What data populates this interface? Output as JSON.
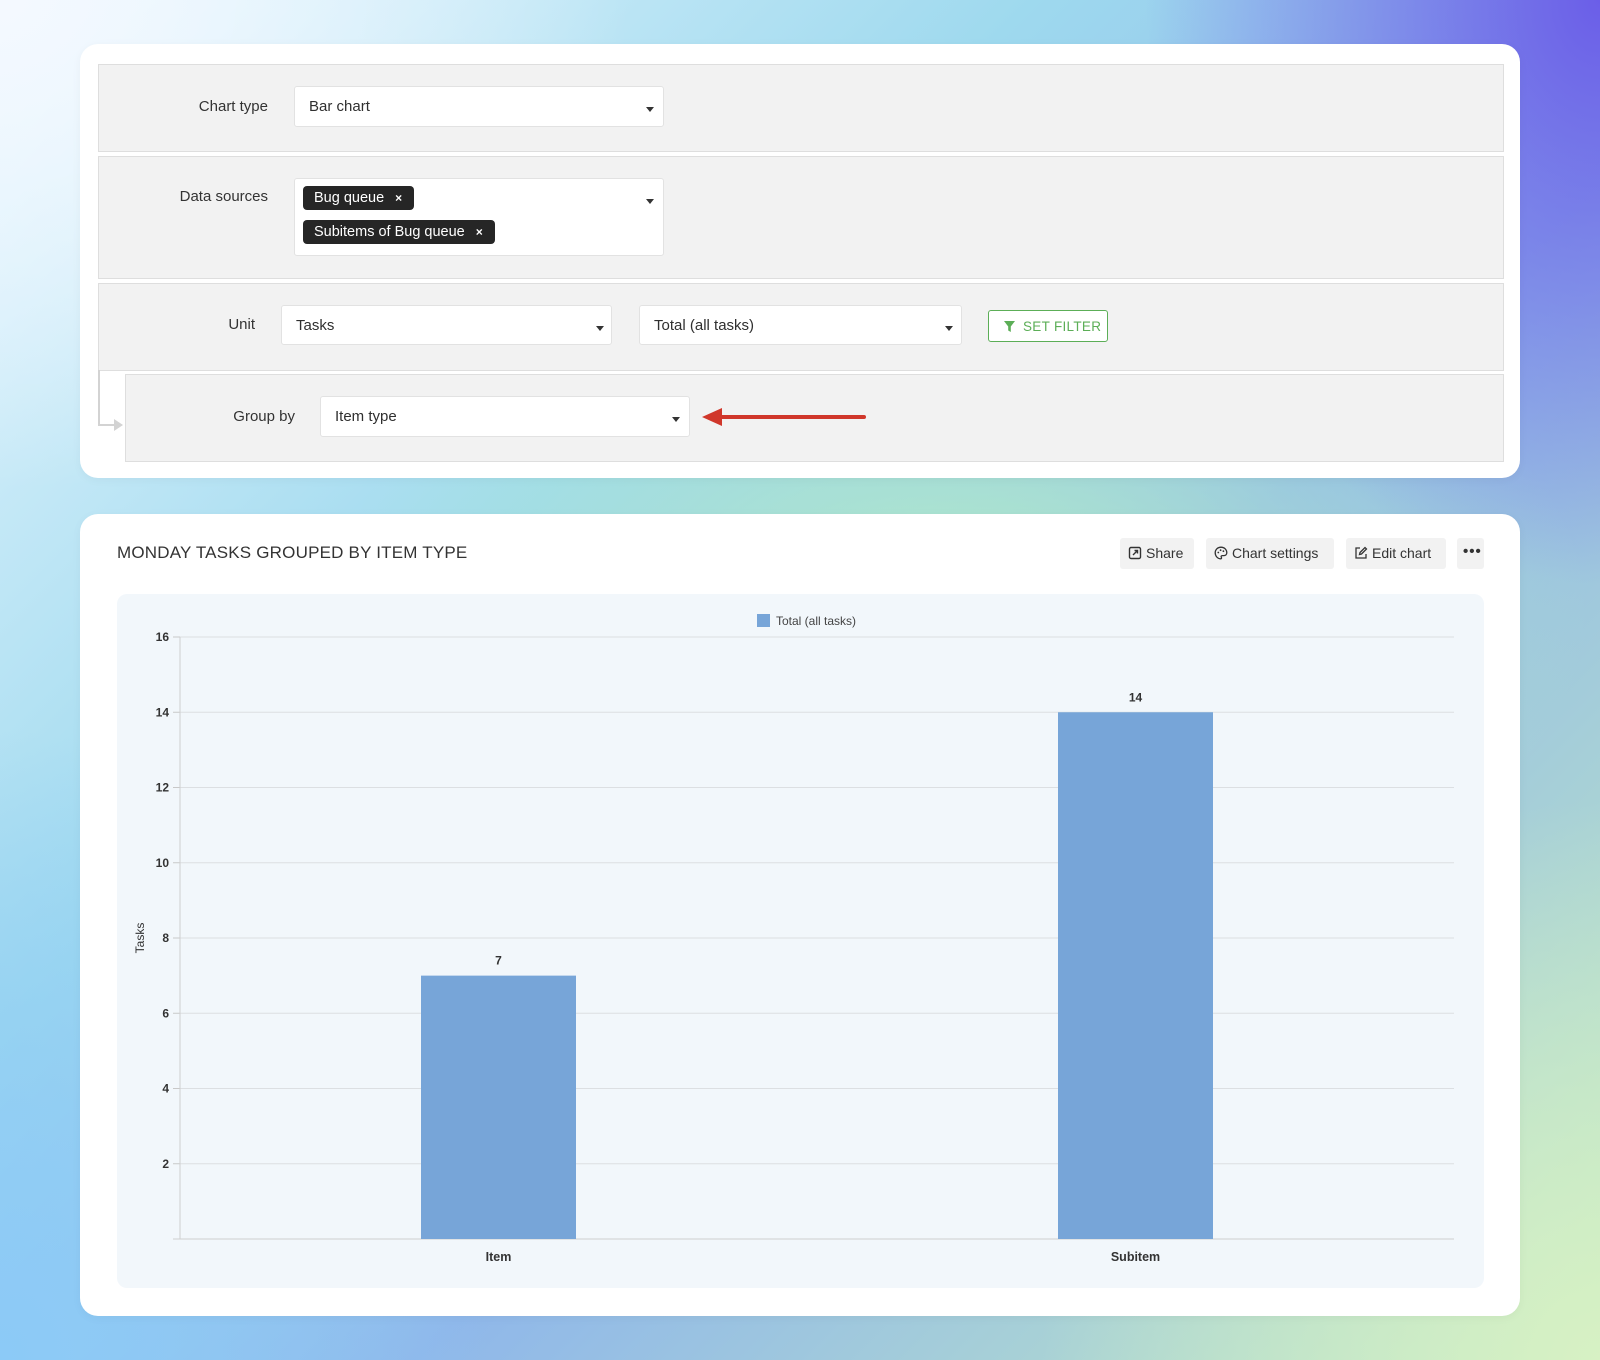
{
  "config": {
    "chart_type": {
      "label": "Chart type",
      "value": "Bar chart"
    },
    "data_sources": {
      "label": "Data sources",
      "tags": [
        "Bug queue",
        "Subitems of Bug queue"
      ],
      "remove_glyph": "×"
    },
    "unit": {
      "label": "Unit",
      "unit_value": "Tasks",
      "measure_value": "Total (all tasks)",
      "filter_label": "SET FILTER"
    },
    "group_by": {
      "label": "Group by",
      "value": "Item type"
    }
  },
  "chart_panel": {
    "title": "MONDAY TASKS GROUPED BY ITEM TYPE",
    "actions": {
      "share": "Share",
      "chart_settings": "Chart settings",
      "edit_chart": "Edit chart",
      "more": "•••"
    }
  },
  "colors": {
    "bar": "#77a5d8",
    "filter_green": "#5cae57",
    "arrow_red": "#d0372b",
    "tag_bg": "#262626"
  },
  "chart_data": {
    "type": "bar",
    "categories": [
      "Item",
      "Subitem"
    ],
    "series": [
      {
        "name": "Total (all tasks)",
        "values": [
          7,
          14
        ]
      }
    ],
    "ylabel": "Tasks",
    "xlabel": "",
    "ylim": [
      0,
      16
    ],
    "yticks": [
      2,
      4,
      6,
      8,
      10,
      12,
      14,
      16
    ],
    "grid": true,
    "legend": "top-center",
    "data_labels": true
  }
}
